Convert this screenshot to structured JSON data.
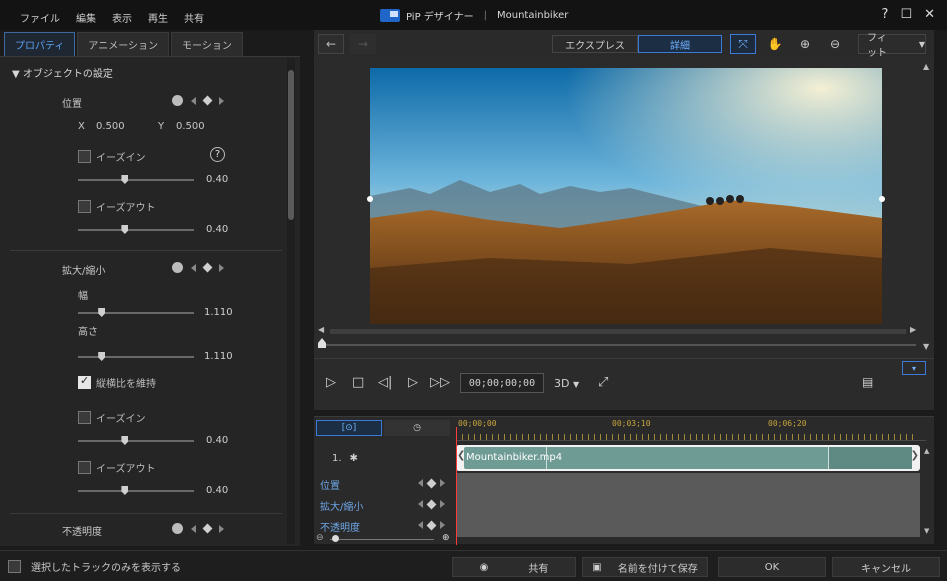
{
  "menu": [
    "ファイル",
    "編集",
    "表示",
    "再生",
    "共有"
  ],
  "title": {
    "app": "PiP デザイナー",
    "file": "Mountainbiker"
  },
  "window_controls": {
    "help": "?",
    "maximize": "☐",
    "close": "✕"
  },
  "tabs": [
    {
      "label": "プロパティ",
      "active": true
    },
    {
      "label": "アニメーション",
      "active": false
    },
    {
      "label": "モーション",
      "active": false
    }
  ],
  "props": {
    "section_title": "オブジェクトの設定",
    "position": {
      "title": "位置",
      "x_label": "X",
      "x_value": "0.500",
      "y_label": "Y",
      "y_value": "0.500",
      "ease_in_label": "イーズイン",
      "ease_in_value": "0.40",
      "ease_in_level": 0.4,
      "ease_out_label": "イーズアウト",
      "ease_out_value": "0.40",
      "ease_out_level": 0.4,
      "help": "?"
    },
    "scale": {
      "title": "拡大/縮小",
      "width_label": "幅",
      "width_value": "1.110",
      "width_level": 0.2,
      "height_label": "高さ",
      "height_value": "1.110",
      "height_level": 0.2,
      "keep_ratio_label": "縦横比を維持",
      "keep_ratio_checked": true,
      "ease_in_label": "イーズイン",
      "ease_in_value": "0.40",
      "ease_in_level": 0.4,
      "ease_out_label": "イーズアウト",
      "ease_out_value": "0.40",
      "ease_out_level": 0.4
    },
    "opacity_title": "不透明度"
  },
  "toolbar": {
    "express_label": "エクスプレス",
    "detail_label": "詳細",
    "fit_label": "フィット"
  },
  "playback": {
    "timecode": "00;00;00;00",
    "mode_3d": "3D"
  },
  "timeline": {
    "ruler_labels": [
      "00;00;00",
      "00;03;10",
      "00;06;20"
    ],
    "track_number": "1.",
    "clip_name": "Mountainbiker.mp4",
    "keyframe_rows": [
      "位置",
      "拡大/縮小",
      "不透明度"
    ]
  },
  "bottom": {
    "checkbox_label": "選択したトラックのみを表示する",
    "share_label": "共有",
    "save_as_label": "名前を付けて保存",
    "ok_label": "OK",
    "cancel_label": "キャンセル"
  },
  "colors": {
    "accent": "#3d7ad8",
    "clip": "#6f9b95",
    "playhead": "#ff3c3c",
    "ruler": "#c9a53a"
  }
}
